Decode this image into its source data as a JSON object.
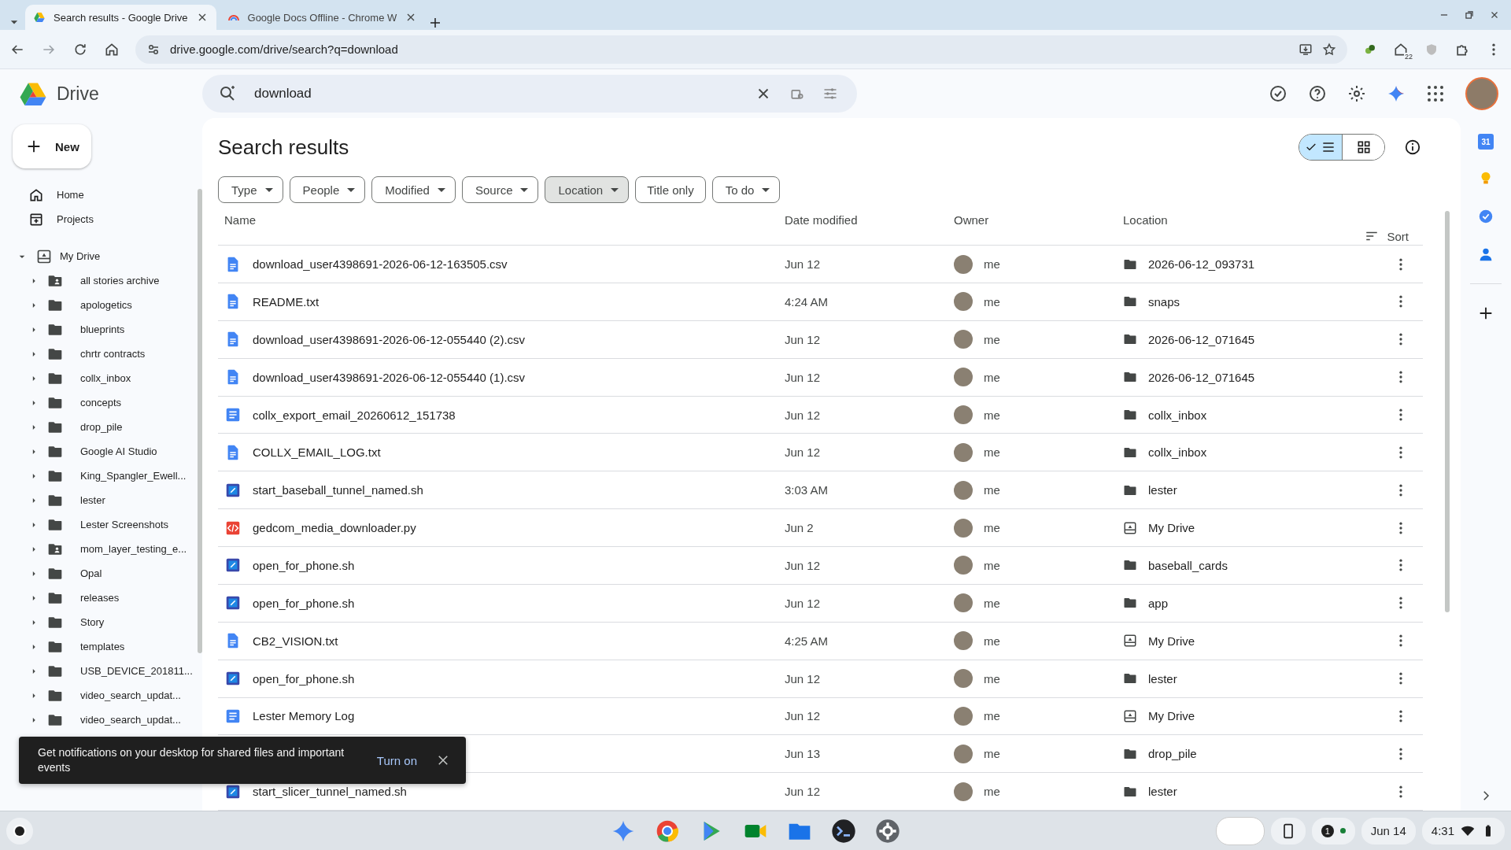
{
  "browser": {
    "tabs": [
      {
        "title": "Search results - Google Drive",
        "selected": true
      },
      {
        "title": "Google Docs Offline - Chrome W",
        "selected": false
      }
    ],
    "address": "drive.google.com/drive/search?q=download",
    "extension_badge": "22"
  },
  "drive": {
    "app_name": "Drive",
    "search": {
      "value": "download"
    }
  },
  "sidebar": {
    "new_button": "New",
    "nav": [
      {
        "label": "Home",
        "kind": "home"
      },
      {
        "label": "Projects",
        "kind": "projects"
      }
    ],
    "tree": {
      "label": "My Drive",
      "expanded": true,
      "children": [
        {
          "label": "all stories archive",
          "kind": "shared",
          "expanded": false
        },
        {
          "label": "apologetics",
          "kind": "folder",
          "expanded": false
        },
        {
          "label": "blueprints",
          "kind": "folder",
          "expanded": false
        },
        {
          "label": "chrtr contracts",
          "kind": "folder",
          "expanded": false
        },
        {
          "label": "collx_inbox",
          "kind": "folder",
          "expanded": false
        },
        {
          "label": "concepts",
          "kind": "folder",
          "expanded": false
        },
        {
          "label": "drop_pile",
          "kind": "folder",
          "expanded": false
        },
        {
          "label": "Google AI Studio",
          "kind": "folder",
          "expanded": false
        },
        {
          "label": "King_Spangler_Ewell...",
          "kind": "folder",
          "expanded": false
        },
        {
          "label": "lester",
          "kind": "folder",
          "expanded": false
        },
        {
          "label": "Lester Screenshots",
          "kind": "folder",
          "expanded": false
        },
        {
          "label": "mom_layer_testing_e...",
          "kind": "shared",
          "expanded": false
        },
        {
          "label": "Opal",
          "kind": "folder",
          "expanded": false
        },
        {
          "label": "releases",
          "kind": "folder",
          "expanded": false
        },
        {
          "label": "Story",
          "kind": "folder",
          "expanded": false
        },
        {
          "label": "templates",
          "kind": "folder",
          "expanded": false
        },
        {
          "label": "USB_DEVICE_201811...",
          "kind": "folder",
          "expanded": false
        },
        {
          "label": "video_search_updat...",
          "kind": "folder",
          "expanded": false
        },
        {
          "label": "video_search_updat...",
          "kind": "folder",
          "expanded": false
        }
      ]
    }
  },
  "results": {
    "title": "Search results",
    "views": [
      {
        "kind": "list",
        "selected": true
      },
      {
        "kind": "grid",
        "selected": false
      }
    ],
    "filters": [
      {
        "label": "Type",
        "dropdown": true,
        "selected": false
      },
      {
        "label": "People",
        "dropdown": true,
        "selected": false
      },
      {
        "label": "Modified",
        "dropdown": true,
        "selected": false
      },
      {
        "label": "Source",
        "dropdown": true,
        "selected": false
      },
      {
        "label": "Location",
        "dropdown": true,
        "selected": true
      },
      {
        "label": "Title only",
        "dropdown": false,
        "selected": false
      },
      {
        "label": "To do",
        "dropdown": true,
        "selected": false
      }
    ],
    "columns": [
      "Name",
      "Date modified",
      "Owner",
      "Location"
    ],
    "sort": "Sort",
    "rows": [
      {
        "kind": "file",
        "name": "download_user4398691-2026-06-12-163505.csv",
        "modified": "Jun 12",
        "owner": "me",
        "location": {
          "label": "2026-06-12_093731",
          "kind": "folder"
        }
      },
      {
        "kind": "file",
        "name": "README.txt",
        "modified": "4:24 AM",
        "owner": "me",
        "location": {
          "label": "snaps",
          "kind": "folder"
        }
      },
      {
        "kind": "file",
        "name": "download_user4398691-2026-06-12-055440 (2).csv",
        "modified": "Jun 12",
        "owner": "me",
        "location": {
          "label": "2026-06-12_071645",
          "kind": "folder"
        }
      },
      {
        "kind": "file",
        "name": "download_user4398691-2026-06-12-055440 (1).csv",
        "modified": "Jun 12",
        "owner": "me",
        "location": {
          "label": "2026-06-12_071645",
          "kind": "folder"
        }
      },
      {
        "kind": "doc",
        "name": "collx_export_email_20260612_151738",
        "modified": "Jun 12",
        "owner": "me",
        "location": {
          "label": "collx_inbox",
          "kind": "folder"
        }
      },
      {
        "kind": "file",
        "name": "COLLX_EMAIL_LOG.txt",
        "modified": "Jun 12",
        "owner": "me",
        "location": {
          "label": "collx_inbox",
          "kind": "folder"
        }
      },
      {
        "kind": "script",
        "name": "start_baseball_tunnel_named.sh",
        "modified": "3:03 AM",
        "owner": "me",
        "location": {
          "label": "lester",
          "kind": "folder"
        }
      },
      {
        "kind": "code",
        "name": "gedcom_media_downloader.py",
        "modified": "Jun 2",
        "owner": "me",
        "location": {
          "label": "My Drive",
          "kind": "drive"
        }
      },
      {
        "kind": "script",
        "name": "open_for_phone.sh",
        "modified": "Jun 12",
        "owner": "me",
        "location": {
          "label": "baseball_cards",
          "kind": "folder"
        }
      },
      {
        "kind": "script",
        "name": "open_for_phone.sh",
        "modified": "Jun 12",
        "owner": "me",
        "location": {
          "label": "app",
          "kind": "folder"
        }
      },
      {
        "kind": "file",
        "name": "CB2_VISION.txt",
        "modified": "4:25 AM",
        "owner": "me",
        "location": {
          "label": "My Drive",
          "kind": "drive"
        }
      },
      {
        "kind": "script",
        "name": "open_for_phone.sh",
        "modified": "Jun 12",
        "owner": "me",
        "location": {
          "label": "lester",
          "kind": "folder"
        }
      },
      {
        "kind": "doc",
        "name": "Lester Memory Log",
        "modified": "Jun 12",
        "owner": "me",
        "location": {
          "label": "My Drive",
          "kind": "drive"
        }
      },
      {
        "modified": "Jun 13",
        "owner": "me",
        "location": {
          "label": "drop_pile",
          "kind": "folder"
        }
      },
      {
        "kind": "script",
        "name": "start_slicer_tunnel_named.sh",
        "modified": "Jun 12",
        "owner": "me",
        "location": {
          "label": "lester",
          "kind": "folder"
        }
      }
    ]
  },
  "side_panel": {
    "calendar_day": "31"
  },
  "toast": {
    "text": "Get notifications on your desktop for shared files and important events",
    "action": "Turn on"
  },
  "shelf": {
    "notification_count": "1",
    "date": "Jun 14",
    "time": "4:31"
  }
}
